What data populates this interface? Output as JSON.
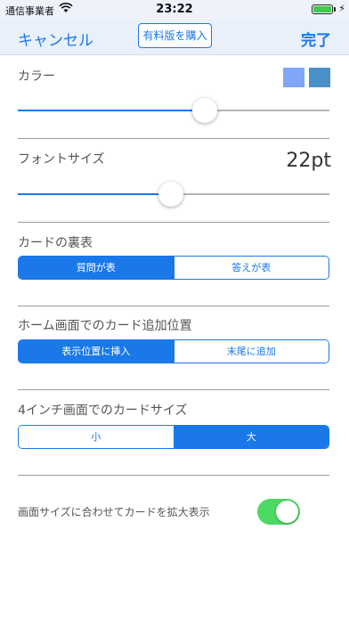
{
  "status_bar": {
    "carrier": "通信事業者",
    "time": "23:22",
    "battery_level": 1.0
  },
  "navbar": {
    "cancel_label": "キャンセル",
    "purchase_label": "有料版を購入",
    "done_label": "完了"
  },
  "color_section": {
    "label": "カラー",
    "swatches": [
      "#7fa7f5",
      "#4a90c8"
    ],
    "slider_value": 0.6
  },
  "font_section": {
    "label": "フォントサイズ",
    "value": "22pt",
    "slider_value": 0.49
  },
  "card_back_section": {
    "label": "カードの裏表",
    "options": [
      "質問が表",
      "答えが表"
    ],
    "selected_index": 0
  },
  "home_position_section": {
    "label": "ホーム画面でのカード追加位置",
    "options": [
      "表示位置に挿入",
      "末尾に追加"
    ],
    "selected_index": 0
  },
  "four_inch_section": {
    "label": "4インチ画面でのカードサイズ",
    "options": [
      "小",
      "大"
    ],
    "selected_index": 1
  },
  "scale_section": {
    "label": "画面サイズに合わせてカードを拡大表示",
    "enabled": true
  },
  "colors": {
    "accent": "#1a78e8",
    "toggle_on": "#4cd964"
  }
}
